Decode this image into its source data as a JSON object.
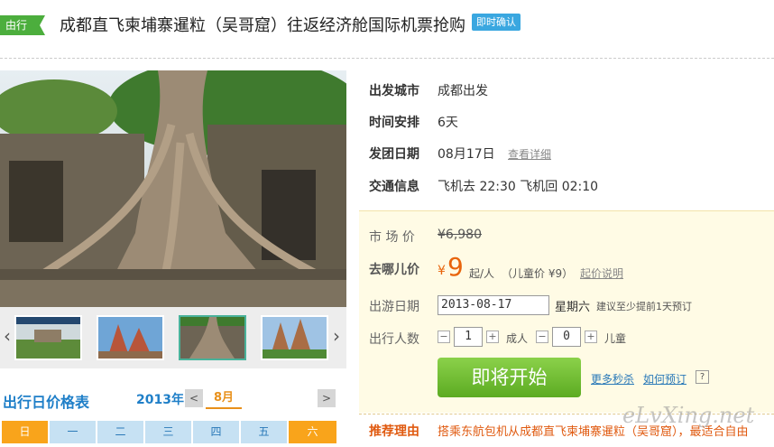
{
  "header": {
    "tag": "由行",
    "title": "成都直飞柬埔寨暹粒（吴哥窟）往返经济舱国际机票抢购",
    "badge": "即时确认"
  },
  "info": {
    "rows": [
      {
        "label": "出发城市",
        "value": "成都出发"
      },
      {
        "label": "时间安排",
        "value": "6天"
      },
      {
        "label": "发团日期",
        "value": "08月17日",
        "link": "查看详细"
      },
      {
        "label": "交通信息",
        "value": "飞机去 22:30 飞机回 02:10"
      }
    ]
  },
  "price": {
    "market_label": "市 场 价",
    "market_value": "¥6,980",
    "qunar_label": "去哪儿价",
    "currency": "¥",
    "amount": "9",
    "unit": "起/人",
    "child_price": "（儿童价 ¥9）",
    "price_note_link": "起价说明",
    "date_label": "出游日期",
    "date_value": "2013-08-17",
    "weekday": "星期六",
    "advice": "建议至少提前1天预订",
    "people_label": "出行人数",
    "adult_count": "1",
    "adult_label": "成人",
    "child_count": "0",
    "child_label": "儿童",
    "minus": "−",
    "plus": "+",
    "cta": "即将开始",
    "more_link": "更多秒杀",
    "how_link": "如何预订",
    "help": "?"
  },
  "recommend": {
    "label": "推荐理由",
    "text": "搭乘东航包机从成都直飞柬埔寨暹粒（吴哥窟），最适合自由"
  },
  "watermark": "eLvXing.net",
  "gallery": {
    "prev": "‹",
    "next": "›"
  },
  "calendar": {
    "title": "出行日价格表",
    "year": "2013年",
    "month": "8月",
    "prev": "<",
    "next": ">",
    "weekdays": [
      "日",
      "一",
      "二",
      "三",
      "四",
      "五",
      "六"
    ]
  },
  "colors": {
    "accent_green": "#4cae3d",
    "badge_blue": "#3aa7e0",
    "price_orange": "#e8640c",
    "calendar_blue": "#1f7fc8"
  }
}
